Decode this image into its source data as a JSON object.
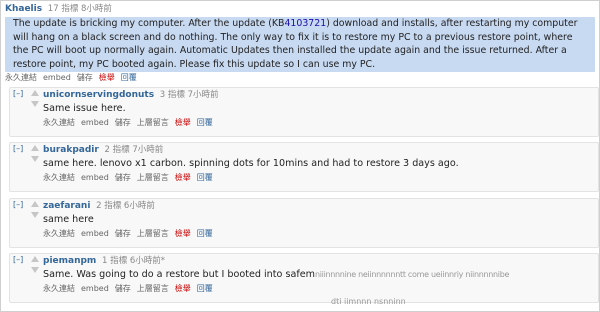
{
  "top_comment": {
    "author": "Khaelis",
    "points": "17 指標 8小時前",
    "body_before": "The update is bricking my computer. After the update (KB",
    "kb_link": "4103721",
    "body_after": ") download and installs, after restarting my computer will hang on a black screen and do nothing. The only way to fix it is to restore my PC to a previous restore point, where the PC will boot up normally again. Automatic Updates then installed the update again and the issue returned. After a restore point, my PC booted again. Please fix this update so I can use my PC.",
    "actions": [
      "永久連結",
      "embed",
      "儲存"
    ],
    "report": "檢舉",
    "reply": "回覆"
  },
  "actions": {
    "permalink": "永久連結",
    "embed": "embed",
    "save": "儲存",
    "parent": "上層留言",
    "report": "檢舉",
    "reply": "回覆"
  },
  "collapse": "[–]",
  "comments": [
    {
      "author": "unicornservingdonuts",
      "meta": "3 指標 7小時前",
      "text": "Same issue here."
    },
    {
      "author": "burakpadir",
      "meta": "2 指標 7小時前",
      "text": "same here. lenovo x1 carbon. spinning dots for 10mins and had to restore 3 days ago."
    },
    {
      "author": "zaefarani",
      "meta": "2 指標 6小時前",
      "text": "same here"
    },
    {
      "author": "piemanpm",
      "meta": "1 指標 6小時前*",
      "text": "Same. Was going to do a restore but I booted into safem",
      "trail": "niiinnnnine  neiinnnnnntt  come  ueiinnriy  niinnnnnibe"
    }
  ],
  "bottom_fade": "dti  iimnnn  nsnninn"
}
